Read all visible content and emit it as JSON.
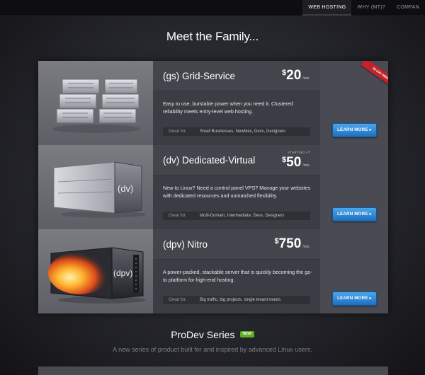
{
  "nav": {
    "items": [
      {
        "label": "WEB HOSTING",
        "active": true
      },
      {
        "label": "WHY (mt)?",
        "active": false
      },
      {
        "label": "COMPAN",
        "active": false
      }
    ]
  },
  "headline": "Meet the Family...",
  "ribbon": "30 DAY MBG",
  "products": [
    {
      "name": "(gs) Grid-Service",
      "currency": "$",
      "price": "20",
      "per": "/mo.",
      "starting": "",
      "description": "Easy to use, burstable power when you need it. Clustered reliability meets entry-level web hosting.",
      "great_label": "Great for:",
      "great_for": "Small Businesses, Newbies, Devs, Designers",
      "cta": "LEARN MORE ▸"
    },
    {
      "name": "(dv) Dedicated-Virtual",
      "currency": "$",
      "price": "50",
      "per": "/mo.",
      "starting": "STARTING AT",
      "description": "New to Linux? Need a control panel VPS? Manage your websites with dedicated resources and unmatched flexibility.",
      "great_label": "Great for:",
      "great_for": "Multi-Domain, Intermediate, Devs, Designers",
      "cta": "LEARN MORE ▸"
    },
    {
      "name": "(dpv) Nitro",
      "currency": "$",
      "price": "750",
      "per": "/mo.",
      "starting": "",
      "description": "A power-packed, stackable server that is quickly becoming the go-to platform for high-end hosting.",
      "great_label": "Great for:",
      "great_for": "Big traffic, big projects, single tenant needs",
      "cta": "LEARN MORE ▸"
    }
  ],
  "server_labels": {
    "dv": "(dv)",
    "dpv": "(dpv)"
  },
  "prodev": {
    "title": "ProDev Series",
    "badge": "NEW!",
    "subtitle": "A new series of product built for and inspired by advanced Linux users."
  },
  "colors": {
    "cta_blue": "#2a86d6",
    "ribbon_red": "#c0242a",
    "badge_green": "#5fae1d"
  }
}
